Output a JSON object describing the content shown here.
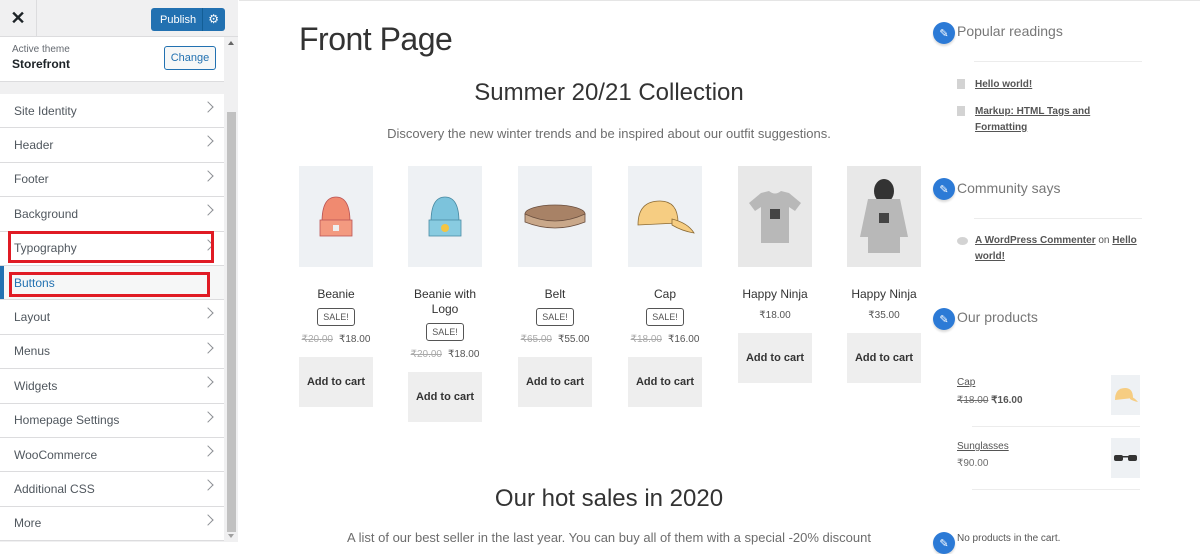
{
  "customizer": {
    "close_label": "✕",
    "publish_label": "Publish",
    "gear_icon": "⚙",
    "active_theme_label": "Active theme",
    "theme_name": "Storefront",
    "change_label": "Change",
    "menu": [
      {
        "label": "Site Identity"
      },
      {
        "label": "Header"
      },
      {
        "label": "Footer"
      },
      {
        "label": "Background"
      },
      {
        "label": "Typography"
      },
      {
        "label": "Buttons"
      },
      {
        "label": "Layout"
      },
      {
        "label": "Menus"
      },
      {
        "label": "Widgets"
      },
      {
        "label": "Homepage Settings"
      },
      {
        "label": "WooCommerce"
      },
      {
        "label": "Additional CSS"
      },
      {
        "label": "More"
      }
    ],
    "active_item": "Buttons",
    "highlighted_items": [
      "Typography",
      "Buttons"
    ]
  },
  "preview": {
    "page_title": "Front Page",
    "section1_title": "Summer 20/21 Collection",
    "section1_sub": "Discovery the new winter trends and be inspired about our outfit suggestions.",
    "products": [
      {
        "name": "Beanie",
        "sale": "SALE!",
        "old_price": "₹20.00",
        "price": "₹18.00",
        "button": "Add to cart"
      },
      {
        "name": "Beanie with Logo",
        "sale": "SALE!",
        "old_price": "₹20.00",
        "price": "₹18.00",
        "button": "Add to cart"
      },
      {
        "name": "Belt",
        "sale": "SALE!",
        "old_price": "₹65.00",
        "price": "₹55.00",
        "button": "Add to cart"
      },
      {
        "name": "Cap",
        "sale": "SALE!",
        "old_price": "₹18.00",
        "price": "₹16.00",
        "button": "Add to cart"
      },
      {
        "name": "Happy Ninja",
        "price": "₹18.00",
        "button": "Add to cart"
      },
      {
        "name": "Happy Ninja",
        "price": "₹35.00",
        "button": "Add to cart"
      }
    ],
    "section2_title": "Our hot sales in 2020",
    "section2_sub": "A list of our best seller in the last year. You can buy all of them with a special -20% discount"
  },
  "widgets": {
    "edit_icon": "✎",
    "popular": {
      "title": "Popular readings",
      "links": [
        "Hello world!",
        "Markup: HTML Tags and Formatting"
      ]
    },
    "community": {
      "title": "Community says",
      "author": "A WordPress Commenter",
      "on": "on",
      "post": "Hello world!"
    },
    "products": {
      "title": "Our products",
      "items": [
        {
          "name": "Cap",
          "old_price": "₹18.00",
          "price": "₹16.00"
        },
        {
          "name": "Sunglasses",
          "price": "₹90.00"
        }
      ]
    },
    "cart_empty": "No products in the cart."
  }
}
